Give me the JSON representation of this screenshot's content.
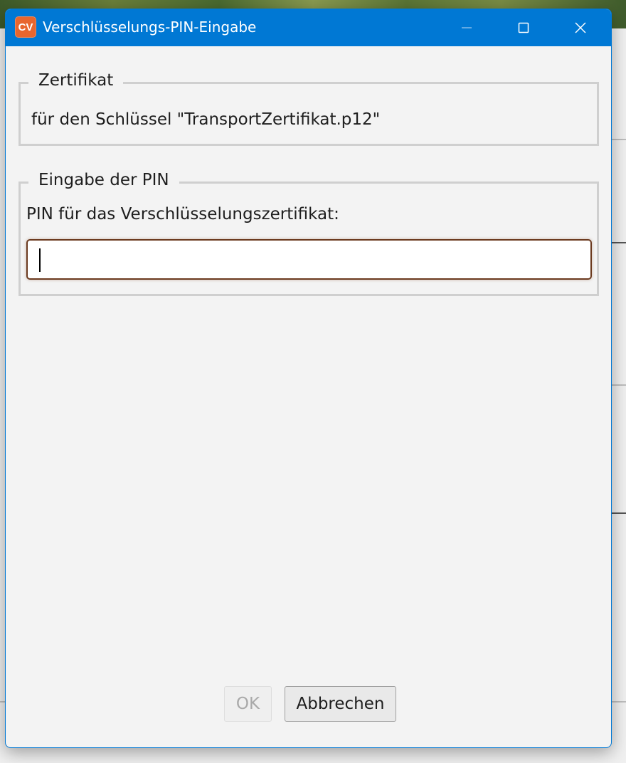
{
  "window": {
    "title": "Verschlüsselungs-PIN-Eingabe",
    "app_icon_text": "CV",
    "accent_color": "#0078d4"
  },
  "certificate_group": {
    "legend": "Zertifikat",
    "text": "für den Schlüssel \"TransportZertifikat.p12\""
  },
  "pin_group": {
    "legend": "Eingabe der PIN",
    "label": "PIN für das Verschlüsselungszertifikat:",
    "input_value": ""
  },
  "buttons": {
    "ok_label": "OK",
    "cancel_label": "Abbrechen"
  },
  "icons": {
    "minimize": "minimize-icon",
    "maximize": "maximize-icon",
    "close": "close-icon"
  }
}
